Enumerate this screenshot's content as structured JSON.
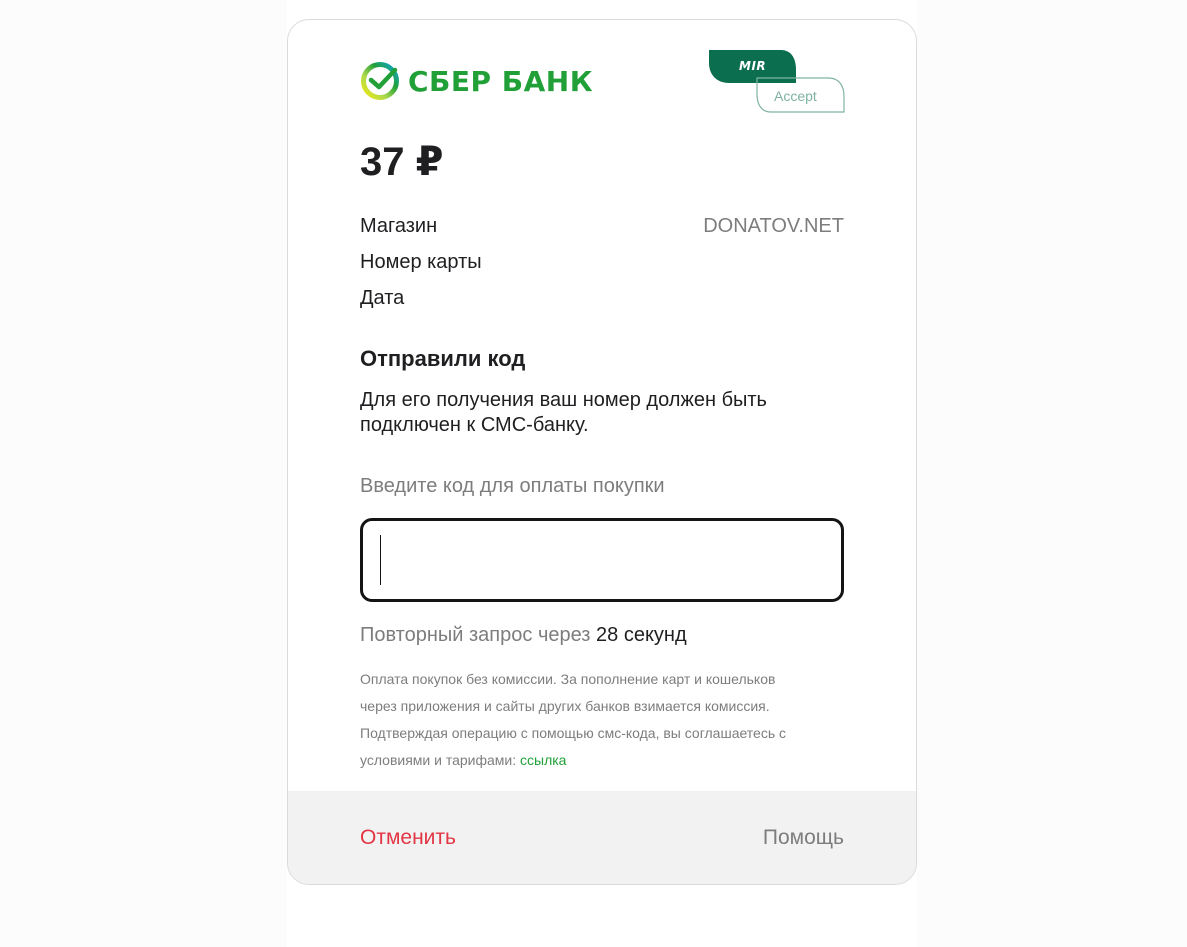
{
  "bank": {
    "logo_text": "СБЕР БАНК",
    "brand_color": "#21a038"
  },
  "payment_system": {
    "mir_label": "MIR",
    "accept_label": "Accept",
    "color": "#0b6e4f"
  },
  "amount": "37 ₽",
  "details": [
    {
      "label": "Магазин",
      "value": "DONATOV.NET"
    },
    {
      "label": "Номер карты",
      "value": ""
    },
    {
      "label": "Дата",
      "value": ""
    }
  ],
  "otp": {
    "heading": "Отправили код",
    "description": "Для его получения ваш номер должен быть подключен к СМС-банку.",
    "input_caption": "Введите код для оплаты покупки",
    "input_value": "",
    "resend_prefix": "Повторный запрос через",
    "resend_time": "28 секунд"
  },
  "terms": {
    "line1": "Оплата покупок без комиссии. За пополнение карт и кошельков",
    "line2": "через приложения и сайты других банков взимается комиссия.",
    "line3": "Подтверждая операцию с помощью смс-кода, вы соглашаетесь с",
    "line4_text": "условиями и тарифами: ",
    "link_label": "ссылка"
  },
  "footer": {
    "cancel_label": "Отменить",
    "help_label": "Помощь"
  },
  "colors": {
    "cancel": "#e23645",
    "muted": "#7d7d7d",
    "text": "#1f1f22"
  }
}
